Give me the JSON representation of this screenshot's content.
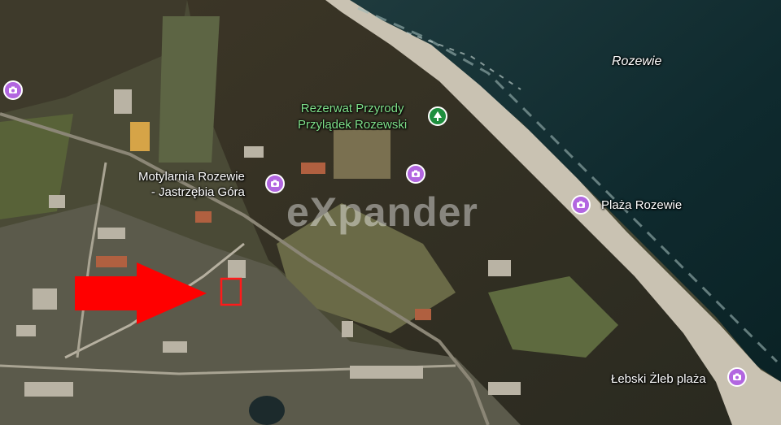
{
  "map": {
    "water_label": "Rozewie",
    "places": [
      {
        "id": "reserve",
        "label": "Rezerwat Przyrody\nPrzylądek Rozewski",
        "icon": "tree-icon"
      },
      {
        "id": "butterfly",
        "label": "Motylarnia Rozewie\n- Jastrzębia Góra",
        "icon": "camera-icon"
      },
      {
        "id": "beach1",
        "label": "Plaża Rozewie",
        "icon": "camera-icon"
      },
      {
        "id": "beach2",
        "label": "Łebski Żleb plaża",
        "icon": "camera-icon"
      }
    ],
    "watermark": "eXpander",
    "colors": {
      "pin": "#b266e0",
      "park_pin": "#1e8e3e",
      "arrow": "#ff0000",
      "plot_outline": "#ff1a1a"
    }
  }
}
